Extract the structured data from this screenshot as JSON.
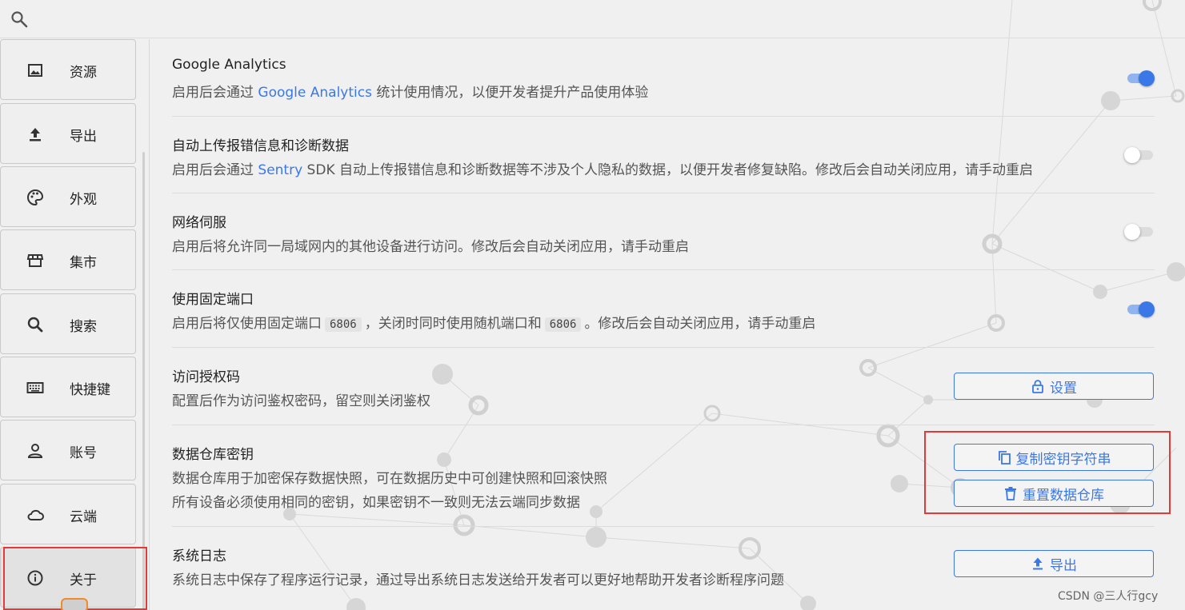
{
  "colors": {
    "accent": "#3b78e7",
    "highlight": "#e03a3a"
  },
  "sidebar": {
    "items": [
      {
        "label": "资源",
        "icon": "image-icon"
      },
      {
        "label": "导出",
        "icon": "upload-icon"
      },
      {
        "label": "外观",
        "icon": "palette-icon"
      },
      {
        "label": "集市",
        "icon": "store-icon"
      },
      {
        "label": "搜索",
        "icon": "search-icon"
      },
      {
        "label": "快捷键",
        "icon": "keyboard-icon"
      },
      {
        "label": "账号",
        "icon": "person-icon"
      },
      {
        "label": "云端",
        "icon": "cloud-icon"
      },
      {
        "label": "关于",
        "icon": "info-icon",
        "active": true
      }
    ]
  },
  "settings": {
    "ga": {
      "title": "Google Analytics",
      "desc_prefix": "启用后会通过 ",
      "desc_link": "Google Analytics",
      "desc_suffix": " 统计使用情况，以便开发者提升产品使用体验",
      "enabled": true
    },
    "sentry": {
      "title": "自动上传报错信息和诊断数据",
      "desc_prefix": "启用后会通过 ",
      "desc_link": "Sentry",
      "desc_suffix": " SDK 自动上传报错信息和诊断数据等不涉及个人隐私的数据，以便开发者修复缺陷。修改后会自动关闭应用，请手动重启",
      "enabled": false
    },
    "network": {
      "title": "网络伺服",
      "desc": "启用后将允许同一局域网内的其他设备进行访问。修改后会自动关闭应用，请手动重启",
      "enabled": false
    },
    "port": {
      "title": "使用固定端口",
      "desc_a": "启用后将仅使用固定端口",
      "code_a": "6806",
      "desc_b": "，关闭时同时使用随机端口和",
      "code_b": "6806",
      "desc_c": "。修改后会自动关闭应用，请手动重启",
      "enabled": true
    },
    "auth": {
      "title": "访问授权码",
      "desc": "配置后作为访问鉴权密码，留空则关闭鉴权",
      "button": "设置"
    },
    "repo_key": {
      "title": "数据仓库密钥",
      "desc1": "数据仓库用于加密保存数据快照，可在数据历史中可创建快照和回滚快照",
      "desc2": "所有设备必须使用相同的密钥，如果密钥不一致则无法云端同步数据",
      "copy_button": "复制密钥字符串",
      "reset_button": "重置数据仓库"
    },
    "syslog": {
      "title": "系统日志",
      "desc": "系统日志中保存了程序运行记录，通过导出系统日志发送给开发者可以更好地帮助开发者诊断程序问题",
      "button": "导出"
    }
  },
  "watermark": "CSDN @三人行gcy"
}
